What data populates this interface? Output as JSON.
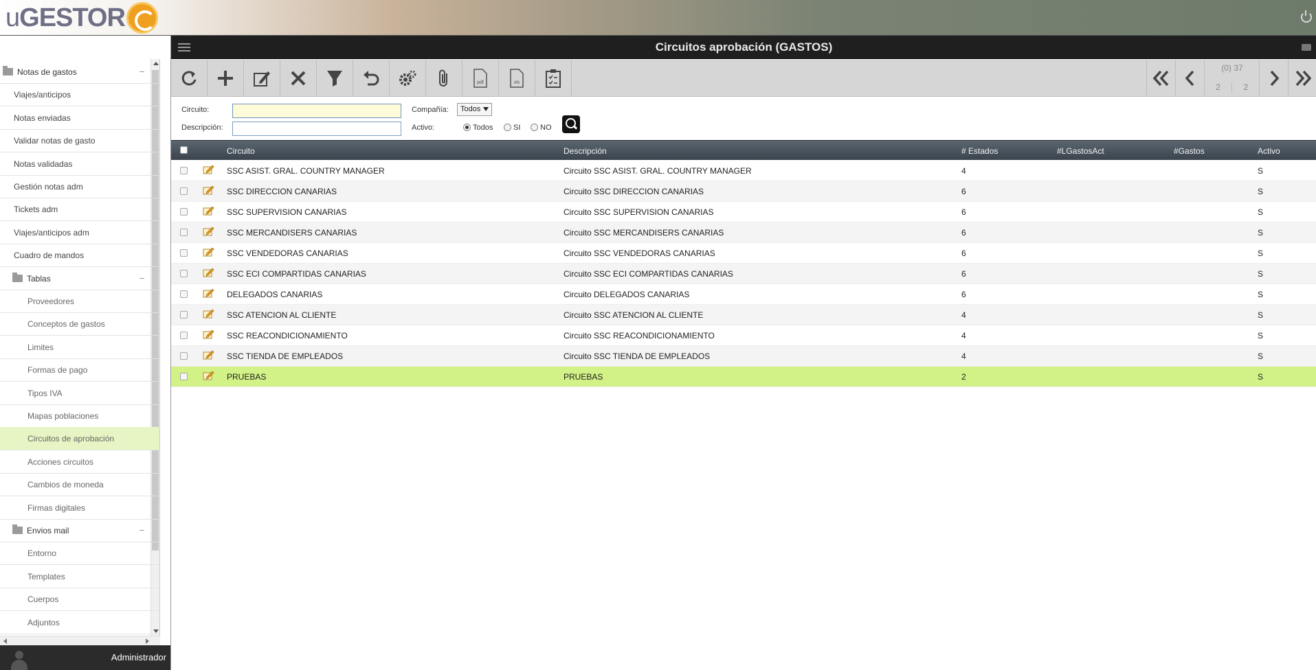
{
  "app": {
    "logo_prefix": "u",
    "logo_brand": "GESTOR"
  },
  "page": {
    "title": "Circuitos aprobación (GASTOS)"
  },
  "sidebar": {
    "groups": {
      "notas": "Notas de gastos",
      "tablas": "Tablas",
      "envios": "Envios mail"
    },
    "items_notas": [
      "Viajes/anticipos",
      "Notas enviadas",
      "Validar notas de gasto",
      "Notas validadas",
      "Gestión notas adm",
      "Tickets adm",
      "Viajes/anticipos adm",
      "Cuadro de mandos"
    ],
    "items_tablas": [
      "Proveedores",
      "Conceptos de gastos",
      "Limites",
      "Formas de pago",
      "Tipos IVA",
      "Mapas poblaciones",
      "Circuitos de aprobación",
      "Acciones circuitos",
      "Cambios de moneda",
      "Firmas digitales"
    ],
    "items_envios": [
      "Entorno",
      "Templates",
      "Cuerpos",
      "Adjuntos"
    ],
    "active_item": "Circuitos de aprobación"
  },
  "user": {
    "name": "Administrador"
  },
  "toolbar": {
    "pdf_label": "pdf",
    "xls_label": "xls"
  },
  "pager": {
    "total": "(0) 37",
    "current": "2",
    "pages": "2"
  },
  "filters": {
    "circuito_label": "Circuito:",
    "circuito_value": "",
    "descripcion_label": "Descripción:",
    "descripcion_value": "",
    "compania_label": "Compañía:",
    "compania_value": "Todos",
    "activo_label": "Activo:",
    "activo_options": [
      "Todos",
      "SI",
      "NO"
    ],
    "activo_selected": "Todos"
  },
  "table": {
    "columns": [
      "Circuito",
      "Descripción",
      "# Estados",
      "#LGastosAct",
      "#Gastos",
      "Activo"
    ],
    "rows": [
      [
        "SSC ASIST. GRAL. COUNTRY MANAGER",
        "Circuito SSC ASIST. GRAL. COUNTRY MANAGER",
        "4",
        "",
        "",
        "S"
      ],
      [
        "SSC DIRECCION CANARIAS",
        "Circuito SSC DIRECCION CANARIAS",
        "6",
        "",
        "",
        "S"
      ],
      [
        "SSC SUPERVISION CANARIAS",
        "Circuito SSC SUPERVISION CANARIAS",
        "6",
        "",
        "",
        "S"
      ],
      [
        "SSC MERCANDISERS CANARIAS",
        "Circuito SSC MERCANDISERS CANARIAS",
        "6",
        "",
        "",
        "S"
      ],
      [
        "SSC VENDEDORAS CANARIAS",
        "Circuito SSC VENDEDORAS CANARIAS",
        "6",
        "",
        "",
        "S"
      ],
      [
        "SSC ECI COMPARTIDAS CANARIAS",
        "Circuito SSC ECI COMPARTIDAS CANARIAS",
        "6",
        "",
        "",
        "S"
      ],
      [
        "DELEGADOS CANARIAS",
        "Circuito DELEGADOS CANARIAS",
        "6",
        "",
        "",
        "S"
      ],
      [
        "SSC ATENCION AL CLIENTE",
        "Circuito SSC ATENCION AL CLIENTE",
        "4",
        "",
        "",
        "S"
      ],
      [
        "SSC REACONDICIONAMIENTO",
        "Circuito SSC REACONDICIONAMIENTO",
        "4",
        "",
        "",
        "S"
      ],
      [
        "SSC TIENDA DE EMPLEADOS",
        "Circuito SSC TIENDA DE EMPLEADOS",
        "4",
        "",
        "",
        "S"
      ],
      [
        "PRUEBAS",
        "PRUEBAS",
        "2",
        "",
        "",
        "S"
      ]
    ],
    "selected_row": 10
  },
  "colors": {
    "accent_selected_row": "#d2f186",
    "sidebar_active": "#e7f5c4",
    "titlebar": "#1f1f1f",
    "logo_orange": "#f0a020"
  },
  "icons": {
    "toolbar": [
      "refresh-icon",
      "add-icon",
      "edit-icon",
      "delete-icon",
      "filter-icon",
      "undo-icon",
      "settings-icon",
      "attachment-icon",
      "pdf-icon",
      "xls-icon",
      "checklist-icon"
    ],
    "pager": [
      "first-page-icon",
      "prev-page-icon",
      "next-page-icon",
      "last-page-icon"
    ]
  }
}
